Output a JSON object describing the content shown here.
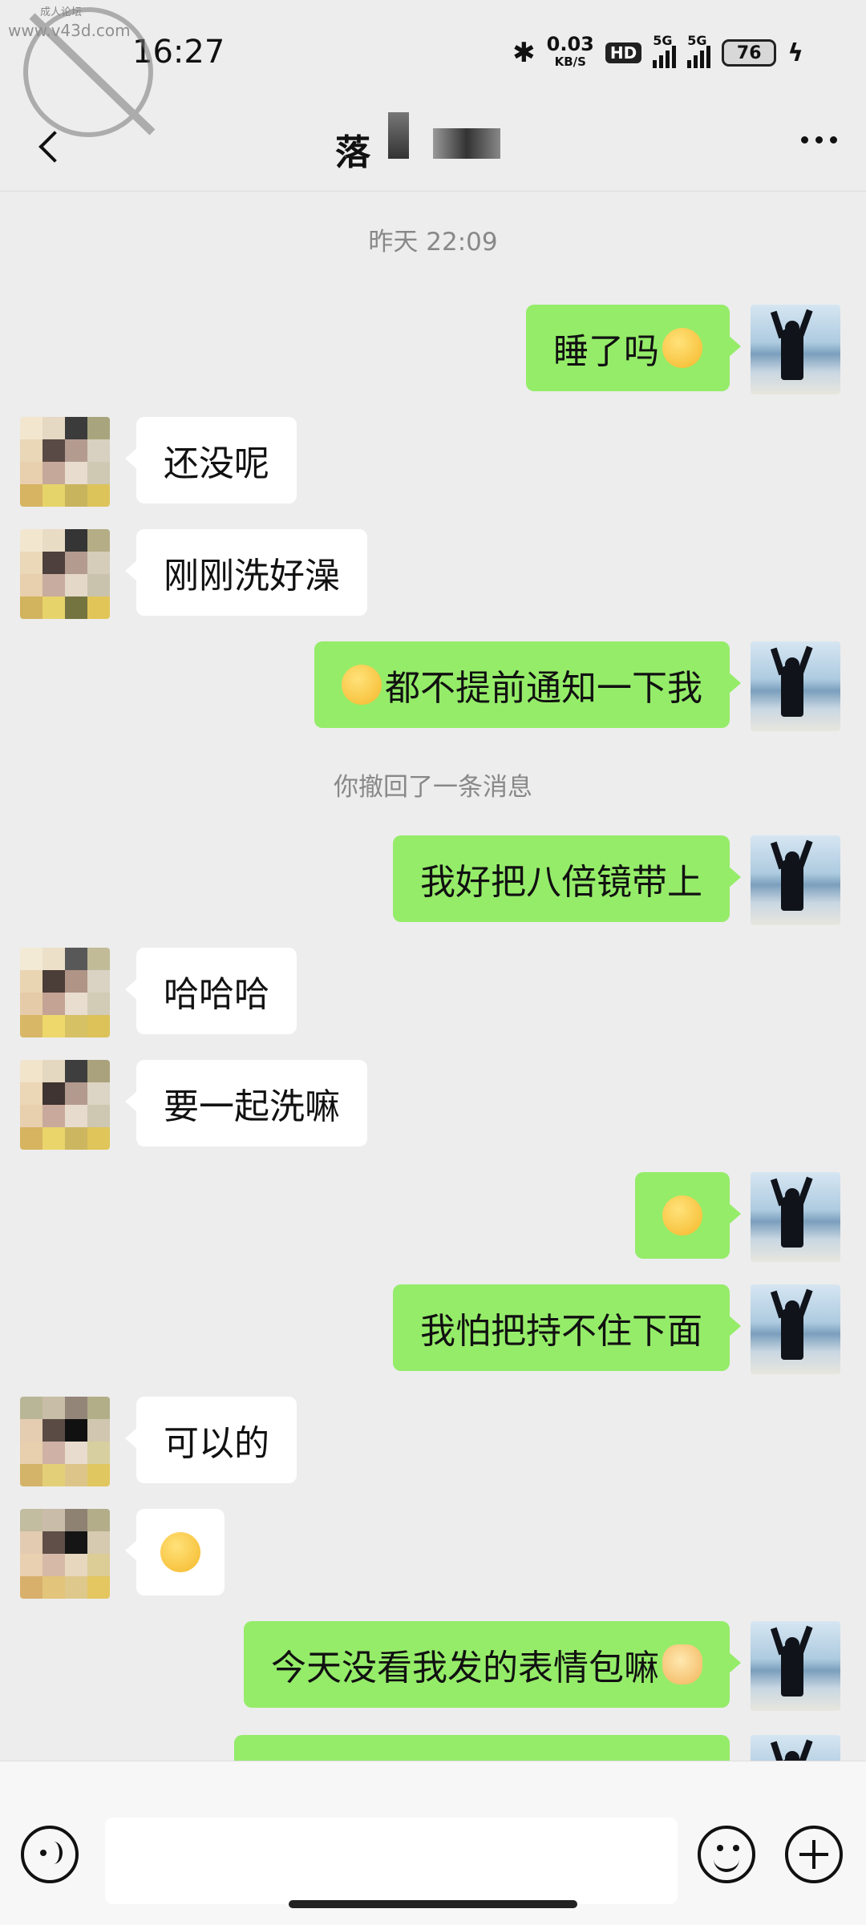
{
  "watermark": {
    "small_text": "成人论坛",
    "url": "www.v43d.com"
  },
  "status_bar": {
    "time": "16:27",
    "net_speed": "0.03",
    "net_unit": "KB/S",
    "hd": "HD",
    "sim1": "5G",
    "sim2": "5G",
    "battery": "76"
  },
  "header": {
    "title": "落"
  },
  "messages": {
    "timestamp": "昨天 22:09",
    "m1": "睡了吗",
    "m2": "还没呢",
    "m3": "刚刚洗好澡",
    "m4": "都不提前通知一下我",
    "recall": "你撤回了一条消息",
    "m5": "我好把八倍镜带上",
    "m6": "哈哈哈",
    "m7": "要一起洗嘛",
    "m9": "我怕把持不住下面",
    "m10": "可以的",
    "m12": "今天没看我发的表情包嘛"
  },
  "icons": {
    "emoji_smirk": "smirk-emoji",
    "emoji_heart_eyes": "heart-eyes-emoji",
    "emoji_grin": "grimace-emoji",
    "emoji_laugh": "tears-of-joy-emoji",
    "emoji_cat": "cat-emoji"
  },
  "colors": {
    "my_bubble": "#95ec69",
    "their_bubble": "#ffffff",
    "background": "#ededed"
  }
}
